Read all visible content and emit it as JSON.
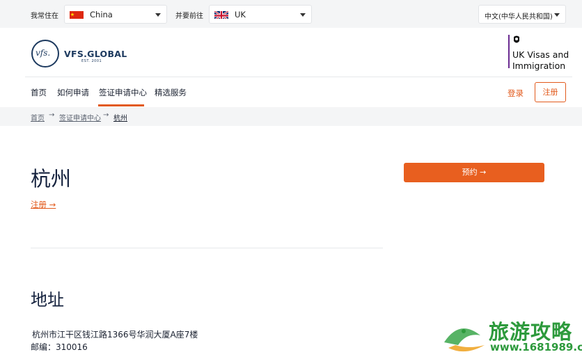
{
  "top_bar": {
    "residence_label": "我常住在",
    "residence_value": "China",
    "destination_label": "并要前往",
    "destination_value": "UK",
    "language_value": "中文(中华人民共和国)"
  },
  "header": {
    "logo_mark": "vfs.",
    "brand": "VFS.GLOBAL",
    "brand_sub": "EST. 2001",
    "partner_line1": "UK Visas and",
    "partner_line2": "Immigration"
  },
  "nav": {
    "items": [
      {
        "label": "首页"
      },
      {
        "label": "如何申请"
      },
      {
        "label": "签证申请中心"
      },
      {
        "label": "精选服务"
      }
    ],
    "login": "登录",
    "register": "注册"
  },
  "breadcrumb": {
    "items": [
      "首页",
      "签证申请中心",
      "杭州"
    ],
    "separator": "→"
  },
  "main": {
    "city": "杭州",
    "register_link": "注册 →",
    "book_button": "预约 →",
    "address_heading": "地址",
    "address_line1": "杭州市江干区钱江路1366号华润大厦A座7楼",
    "address_line2": "邮编：310016"
  },
  "watermark": {
    "title": "旅游攻略",
    "url": "www.1681989.cn"
  },
  "colors": {
    "accent": "#e25a1c",
    "button": "#e85f1f",
    "navy": "#1d3a5f",
    "ukvi_purple": "#6b2c91",
    "watermark_green": "#2d9a3c"
  }
}
